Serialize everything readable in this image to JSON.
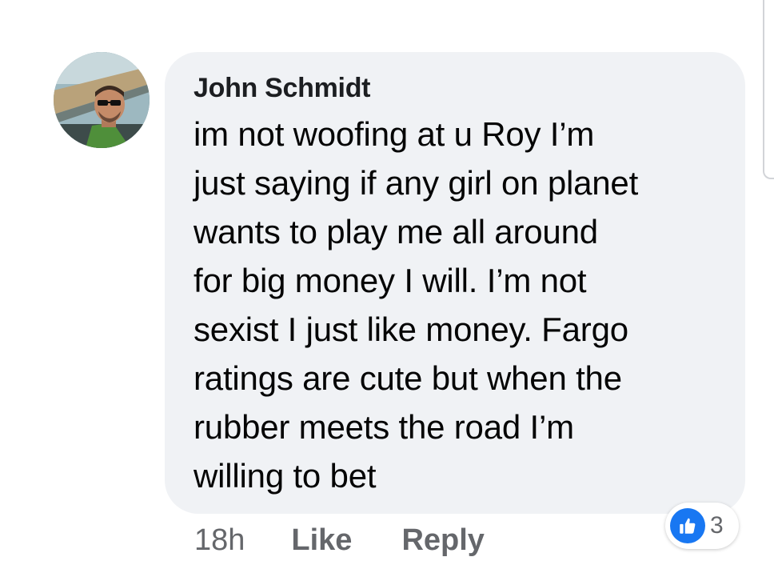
{
  "comment": {
    "author": "John Schmidt",
    "text_lines": [
      "im not woofing at u Roy I’m",
      "just saying if any girl on planet",
      "wants to play me all around",
      "for big money I will. I’m not",
      "sexist I just like money. Fargo",
      "ratings are cute but when the",
      "rubber meets the road I’m",
      "willing to bet"
    ],
    "timestamp": "18h",
    "like_label": "Like",
    "reply_label": "Reply",
    "reaction_count": "3",
    "reaction_icon": "thumbs-up-icon"
  },
  "colors": {
    "bubble_bg": "#f0f2f5",
    "secondary_text": "#65676b",
    "like_blue": "#1877f2"
  }
}
